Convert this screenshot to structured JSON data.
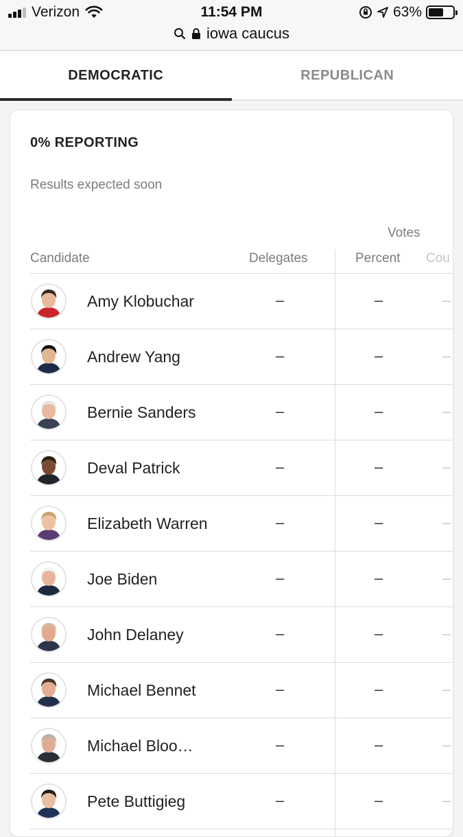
{
  "status_bar": {
    "carrier": "Verizon",
    "time": "11:54 PM",
    "battery": "63%",
    "battery_level": 0.63,
    "url": "iowa caucus",
    "icons": [
      "signal-icon",
      "wifi-icon",
      "orientation-lock-icon",
      "location-icon",
      "battery-icon",
      "search-icon",
      "lock-icon"
    ]
  },
  "tabs": [
    {
      "label": "DEMOCRATIC",
      "active": true
    },
    {
      "label": "REPUBLICAN",
      "active": false
    }
  ],
  "results": {
    "reporting": "0% REPORTING",
    "status": "Results expected soon",
    "votes_header": "Votes",
    "columns": {
      "candidate": "Candidate",
      "delegates": "Delegates",
      "percent": "Percent",
      "count": "Cou"
    },
    "candidates": [
      {
        "name": "Amy Klobuchar",
        "delegates": "–",
        "percent": "–",
        "count": "–",
        "hair": "#3a2a1f",
        "skin": "#e8b99a",
        "shirt": "#c8262b"
      },
      {
        "name": "Andrew Yang",
        "delegates": "–",
        "percent": "–",
        "count": "–",
        "hair": "#111111",
        "skin": "#e1b78f",
        "shirt": "#1d2b45"
      },
      {
        "name": "Bernie Sanders",
        "delegates": "–",
        "percent": "–",
        "count": "–",
        "hair": "#e6e6e6",
        "skin": "#e9b8a0",
        "shirt": "#3a4152"
      },
      {
        "name": "Deval Patrick",
        "delegates": "–",
        "percent": "–",
        "count": "–",
        "hair": "#2a1c14",
        "skin": "#7a4a32",
        "shirt": "#22252b"
      },
      {
        "name": "Elizabeth Warren",
        "delegates": "–",
        "percent": "–",
        "count": "–",
        "hair": "#c9a071",
        "skin": "#ecc2a3",
        "shirt": "#5b3b70"
      },
      {
        "name": "Joe Biden",
        "delegates": "–",
        "percent": "–",
        "count": "–",
        "hair": "#f2f2f2",
        "skin": "#e7b49b",
        "shirt": "#1e2a40"
      },
      {
        "name": "John Delaney",
        "delegates": "–",
        "percent": "–",
        "count": "–",
        "hair": "#d9b89d",
        "skin": "#e4a98e",
        "shirt": "#2c3648"
      },
      {
        "name": "Michael Bennet",
        "delegates": "–",
        "percent": "–",
        "count": "–",
        "hair": "#4b3a2b",
        "skin": "#e2ad91",
        "shirt": "#24304a"
      },
      {
        "name": "Michael Bloo…",
        "delegates": "–",
        "percent": "–",
        "count": "–",
        "hair": "#b9b2a8",
        "skin": "#e0ac93",
        "shirt": "#2b2f38"
      },
      {
        "name": "Pete Buttigieg",
        "delegates": "–",
        "percent": "–",
        "count": "–",
        "hair": "#2a1d15",
        "skin": "#e9bd9f",
        "shirt": "#1f3356"
      }
    ]
  }
}
